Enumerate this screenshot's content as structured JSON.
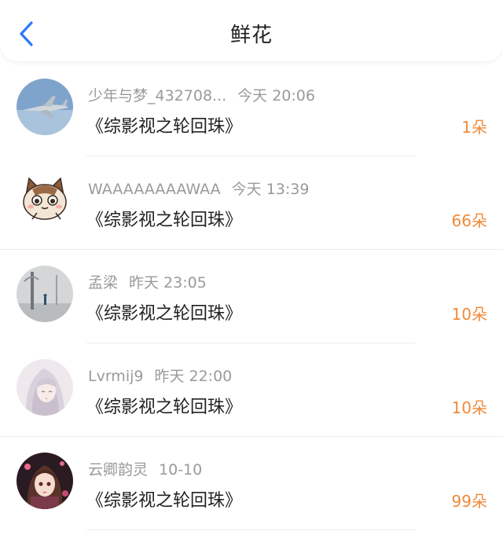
{
  "header": {
    "title": "鲜花"
  },
  "colors": {
    "accent": "#2b7bf6",
    "count": "#f08a3a"
  },
  "rows": [
    {
      "user": "少年与梦_432708...",
      "time": "今天 20:06",
      "book": "《综影视之轮回珠》",
      "count": "1朵",
      "avatar": "jet-avatar"
    },
    {
      "user": "WAAAAAAAAWAA",
      "time": "今天 13:39",
      "book": "《综影视之轮回珠》",
      "count": "66朵",
      "avatar": "cat-avatar"
    },
    {
      "user": "孟梁",
      "time": "昨天 23:05",
      "book": "《综影视之轮回珠》",
      "count": "10朵",
      "avatar": "landscape-avatar"
    },
    {
      "user": "Lvrmij9",
      "time": "昨天 22:00",
      "book": "《综影视之轮回珠》",
      "count": "10朵",
      "avatar": "anime-girl-avatar"
    },
    {
      "user": "云卿韵灵",
      "time": "10-10",
      "book": "《综影视之轮回珠》",
      "count": "99朵",
      "avatar": "anime-girl-dark-avatar"
    }
  ]
}
